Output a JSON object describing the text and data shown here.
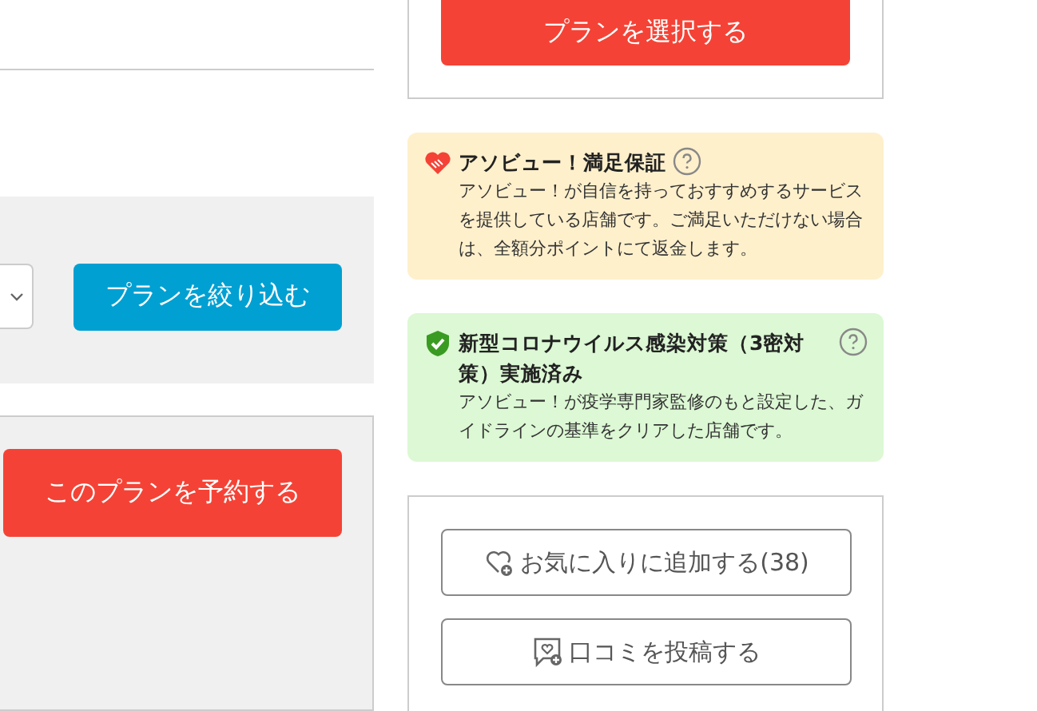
{
  "filter": {
    "button": "プランを絞り込む"
  },
  "plan": {
    "reserve_button": "このプランを予約する"
  },
  "side": {
    "select_button": "プランを選択する",
    "notices": [
      {
        "kind": "guarantee",
        "title": "アソビュー！満足保証",
        "text": "アソビュー！が自信を持っておすすめするサービスを提供している店舗です。ご満足いただけない場合は、全額分ポイントにて返金します。"
      },
      {
        "kind": "safety",
        "title": "新型コロナウイルス感染対策（3密対策）実施済み",
        "text": "アソビュー！が疫学専門家監修のもと設定した、ガイドラインの基準をクリアした店舗です。"
      }
    ],
    "actions": [
      {
        "kind": "favorite",
        "label": "お気に入りに追加する(38)"
      },
      {
        "kind": "review",
        "label": "口コミを投稿する"
      }
    ]
  }
}
